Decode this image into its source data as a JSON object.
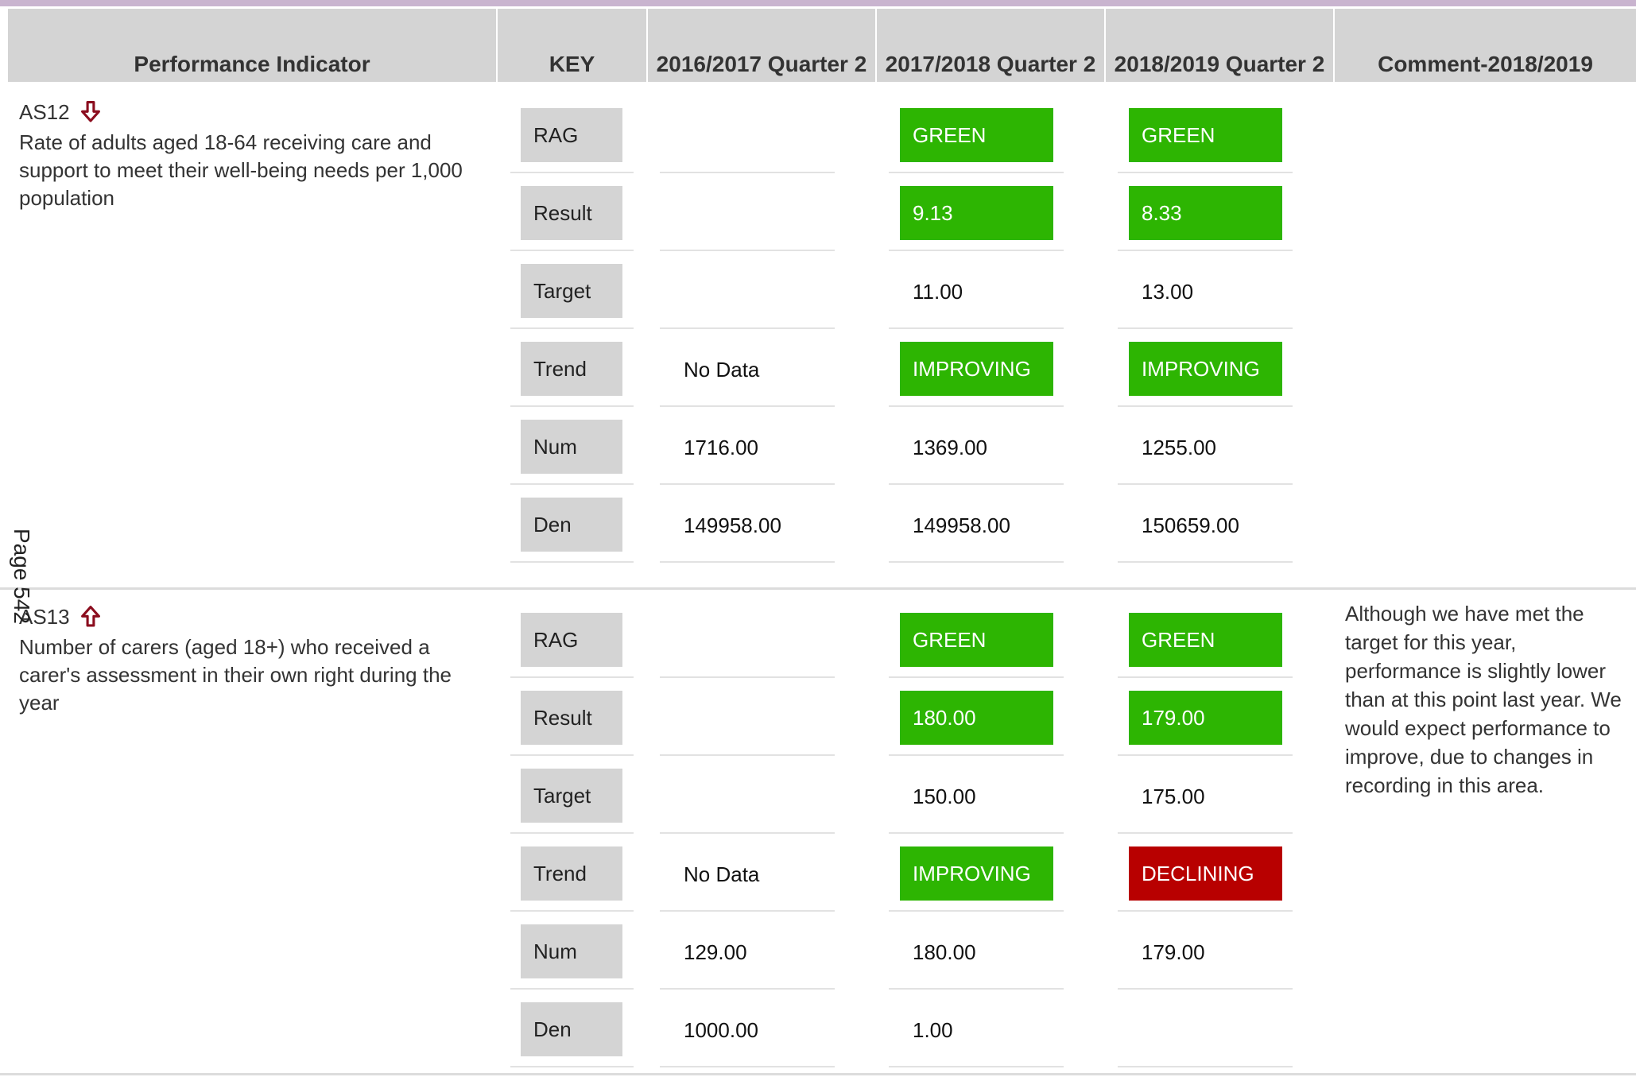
{
  "headers": {
    "indicator": "Performance Indicator",
    "key": "KEY",
    "q2016": "2016/2017 Quarter 2",
    "q2017": "2017/2018 Quarter 2",
    "q2018": "2018/2019 Quarter 2",
    "comment": "Comment-2018/2019"
  },
  "colors": {
    "green": "#2db502",
    "red": "#b80000",
    "header_bg": "#d4d4d4",
    "key_bg": "#d4d4d4",
    "top_bar": "#c9b4cf",
    "arrow": "#8b0d1e"
  },
  "page_label": "Page 542",
  "indicators": [
    {
      "code": "AS12",
      "arrow_icon": "arrow-down-icon",
      "description": "Rate of adults aged 18-64 receiving care and support to meet their well-being needs per 1,000 population",
      "rows": [
        {
          "key": "RAG",
          "q2016": "",
          "q2017": "GREEN",
          "q2017_status": "green",
          "q2018": "GREEN",
          "q2018_status": "green"
        },
        {
          "key": "Result",
          "q2016": "",
          "q2017": "9.13",
          "q2017_status": "green",
          "q2018": "8.33",
          "q2018_status": "green"
        },
        {
          "key": "Target",
          "q2016": "",
          "q2017": "11.00",
          "q2018": "13.00"
        },
        {
          "key": "Trend",
          "q2016": "No Data",
          "q2017": "IMPROVING",
          "q2017_status": "green",
          "q2018": "IMPROVING",
          "q2018_status": "green"
        },
        {
          "key": "Num",
          "q2016": "1716.00",
          "q2017": "1369.00",
          "q2018": "1255.00"
        },
        {
          "key": "Den",
          "q2016": "149958.00",
          "q2017": "149958.00",
          "q2018": "150659.00"
        }
      ],
      "comment": ""
    },
    {
      "code": "AS13",
      "arrow_icon": "arrow-up-icon",
      "description": "Number of carers (aged 18+) who received a carer's assessment in their own right during the year",
      "rows": [
        {
          "key": "RAG",
          "q2016": "",
          "q2017": "GREEN",
          "q2017_status": "green",
          "q2018": "GREEN",
          "q2018_status": "green"
        },
        {
          "key": "Result",
          "q2016": "",
          "q2017": "180.00",
          "q2017_status": "green",
          "q2018": "179.00",
          "q2018_status": "green"
        },
        {
          "key": "Target",
          "q2016": "",
          "q2017": "150.00",
          "q2018": "175.00"
        },
        {
          "key": "Trend",
          "q2016": "No Data",
          "q2017": "IMPROVING",
          "q2017_status": "green",
          "q2018": "DECLINING",
          "q2018_status": "red"
        },
        {
          "key": "Num",
          "q2016": "129.00",
          "q2017": "180.00",
          "q2018": "179.00"
        },
        {
          "key": "Den",
          "q2016": "1000.00",
          "q2017": "1.00",
          "q2018": ""
        }
      ],
      "comment": "Although we have met the target for this year, performance is slightly lower than at this point last year. We would expect performance to improve, due to changes in recording in this area."
    }
  ]
}
